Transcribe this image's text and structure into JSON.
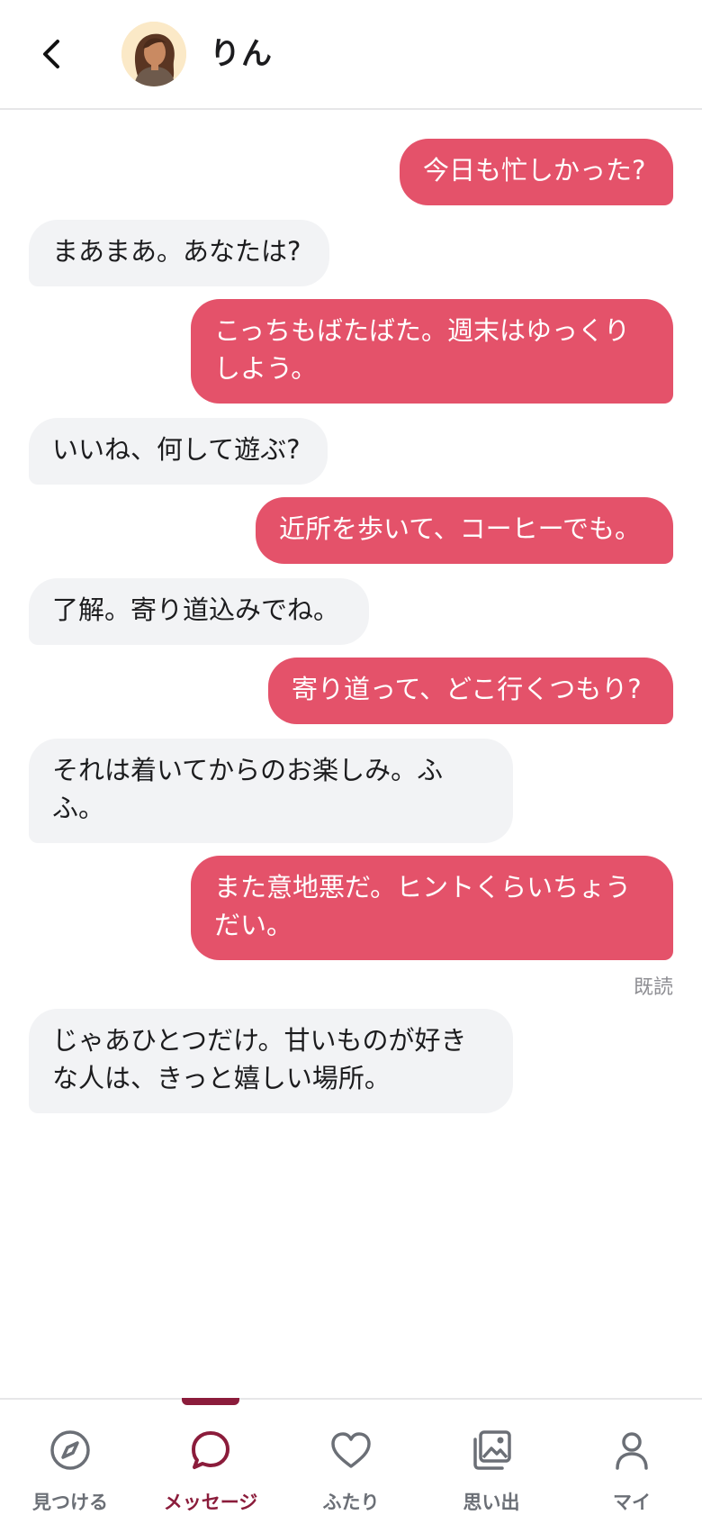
{
  "header": {
    "back_icon": "chevron-left-icon",
    "contact_name": "りん"
  },
  "messages": [
    {
      "from": "me",
      "text": "今日も忙しかった?"
    },
    {
      "from": "them",
      "text": "まあまあ。あなたは?"
    },
    {
      "from": "me",
      "text": "こっちもばたばた。週末はゆっくりしよう。"
    },
    {
      "from": "them",
      "text": "いいね、何して遊ぶ?"
    },
    {
      "from": "me",
      "text": "近所を歩いて、コーヒーでも。"
    },
    {
      "from": "them",
      "text": "了解。寄り道込みでね。"
    },
    {
      "from": "me",
      "text": "寄り道って、どこ行くつもり?"
    },
    {
      "from": "them",
      "text": "それは着いてからのお楽しみ。ふふ。"
    },
    {
      "from": "me",
      "text": "また意地悪だ。ヒントくらいちょうだい。"
    },
    {
      "from": "them",
      "text": "じゃあひとつだけ。甘いものが好きな人は、きっと嬉しい場所。"
    }
  ],
  "read_receipt": "既読",
  "colors": {
    "my_bubble": "#e4526a",
    "their_bubble": "#f2f3f5",
    "accent": "#8b1c3b"
  },
  "bottom_nav": {
    "items": [
      {
        "label": "見つける",
        "icon": "compass-icon",
        "active": false
      },
      {
        "label": "メッセージ",
        "icon": "chat-bubble-icon",
        "active": true
      },
      {
        "label": "ふたり",
        "icon": "heart-icon",
        "active": false
      },
      {
        "label": "思い出",
        "icon": "photo-album-icon",
        "active": false
      },
      {
        "label": "マイ",
        "icon": "user-icon",
        "active": false
      }
    ]
  }
}
